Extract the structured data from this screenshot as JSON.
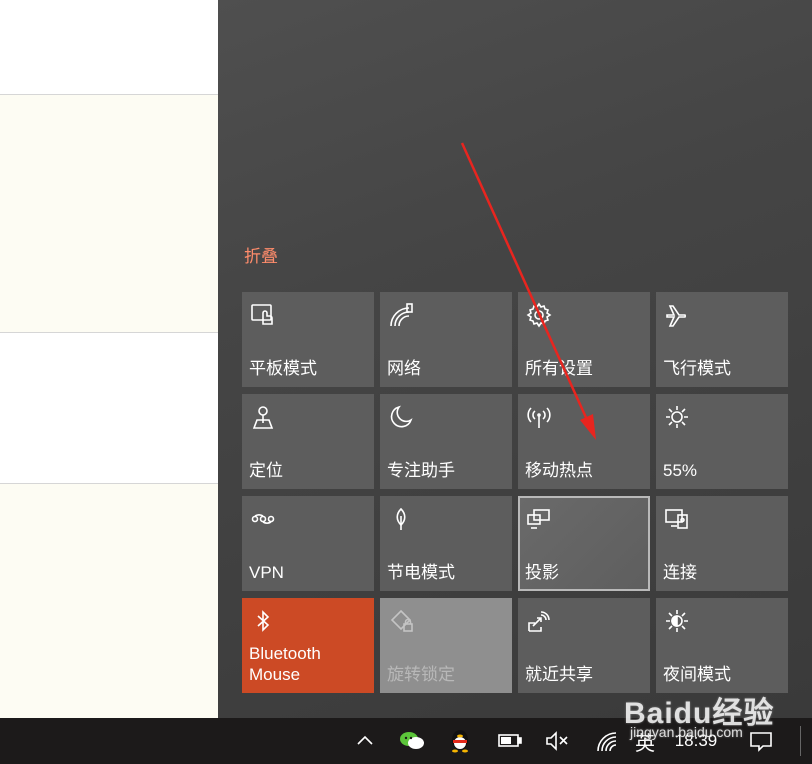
{
  "action_center": {
    "collapse_label": "折叠",
    "tiles": [
      {
        "label": "平板模式",
        "icon": "tablet-mode-icon",
        "state": "off"
      },
      {
        "label": "网络",
        "icon": "network-icon",
        "state": "off"
      },
      {
        "label": "所有设置",
        "icon": "gear-icon",
        "state": "off"
      },
      {
        "label": "飞行模式",
        "icon": "airplane-icon",
        "state": "off"
      },
      {
        "label": "定位",
        "icon": "location-icon",
        "state": "off"
      },
      {
        "label": "专注助手",
        "icon": "moon-icon",
        "state": "off"
      },
      {
        "label": "移动热点",
        "icon": "hotspot-icon",
        "state": "off"
      },
      {
        "label": "55%",
        "icon": "brightness-icon",
        "state": "off"
      },
      {
        "label": "VPN",
        "icon": "vpn-icon",
        "state": "off"
      },
      {
        "label": "节电模式",
        "icon": "battery-saver-icon",
        "state": "off"
      },
      {
        "label": "投影",
        "icon": "project-icon",
        "state": "focused"
      },
      {
        "label": "连接",
        "icon": "connect-icon",
        "state": "off"
      },
      {
        "label": "Bluetooth\nMouse",
        "icon": "bluetooth-icon",
        "state": "on"
      },
      {
        "label": "旋转锁定",
        "icon": "rotation-lock-icon",
        "state": "disabled"
      },
      {
        "label": "就近共享",
        "icon": "nearby-share-icon",
        "state": "off"
      },
      {
        "label": "夜间模式",
        "icon": "night-light-icon",
        "state": "off"
      }
    ],
    "accent_color": "#cc4a25"
  },
  "taskbar": {
    "lang": "英",
    "clock": "18:39",
    "icons": [
      "chevron-up-icon",
      "wechat-icon",
      "qq-icon",
      "battery-icon",
      "volume-muted-icon",
      "wifi-icon",
      "notification-icon"
    ]
  },
  "watermark": {
    "brand": "Baidu经验",
    "url": "jingyan.baidu.com"
  }
}
